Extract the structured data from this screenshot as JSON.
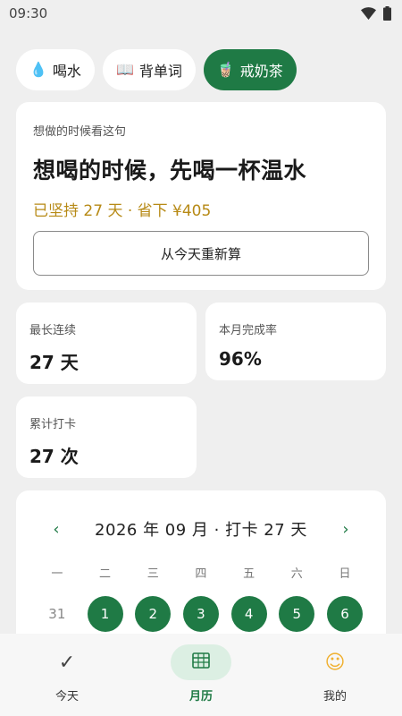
{
  "status_bar": {
    "time": "09:30",
    "wifi_icon": "wifi-icon",
    "battery_icon": "battery-icon"
  },
  "tabs": [
    {
      "label": "喝水",
      "icon": "💧",
      "icon_name": "water-drop-icon",
      "active": false
    },
    {
      "label": "背单词",
      "icon": "📖",
      "icon_name": "open-book-icon",
      "active": false
    },
    {
      "label": "戒奶茶",
      "icon": "🧋",
      "icon_name": "bubble-tea-icon",
      "active": true
    }
  ],
  "hero": {
    "hint": "想做的时候看这句",
    "title": "想喝的时候，先喝一杯温水",
    "progress": "已坚持 27 天 · 省下 ¥405",
    "reset_label": "从今天重新算"
  },
  "stats": [
    {
      "label": "最长连续",
      "value": "27 天"
    },
    {
      "label": "本月完成率",
      "value": "96%"
    },
    {
      "label": "累计打卡",
      "value": "27 次"
    }
  ],
  "calendar": {
    "prev": "‹",
    "next": "›",
    "title": "2026 年 09 月 · 打卡 27 天",
    "weekdays": [
      "一",
      "二",
      "三",
      "四",
      "五",
      "六",
      "日"
    ],
    "days": [
      {
        "label": "31",
        "checked": false
      },
      {
        "label": "1",
        "checked": true
      },
      {
        "label": "2",
        "checked": true
      },
      {
        "label": "3",
        "checked": true
      },
      {
        "label": "4",
        "checked": true
      },
      {
        "label": "5",
        "checked": true
      },
      {
        "label": "6",
        "checked": true
      }
    ]
  },
  "bottom_nav": [
    {
      "label": "今天",
      "icon": "✓",
      "icon_name": "check-icon",
      "active": false
    },
    {
      "label": "月历",
      "icon": "calendar-grid",
      "icon_name": "calendar-grid-icon",
      "active": true
    },
    {
      "label": "我的",
      "icon": "☺",
      "icon_name": "smiley-face-icon",
      "active": false
    }
  ],
  "colors": {
    "accent": "#1f7a45",
    "progress_text": "#b78a16",
    "background": "#efefef"
  }
}
